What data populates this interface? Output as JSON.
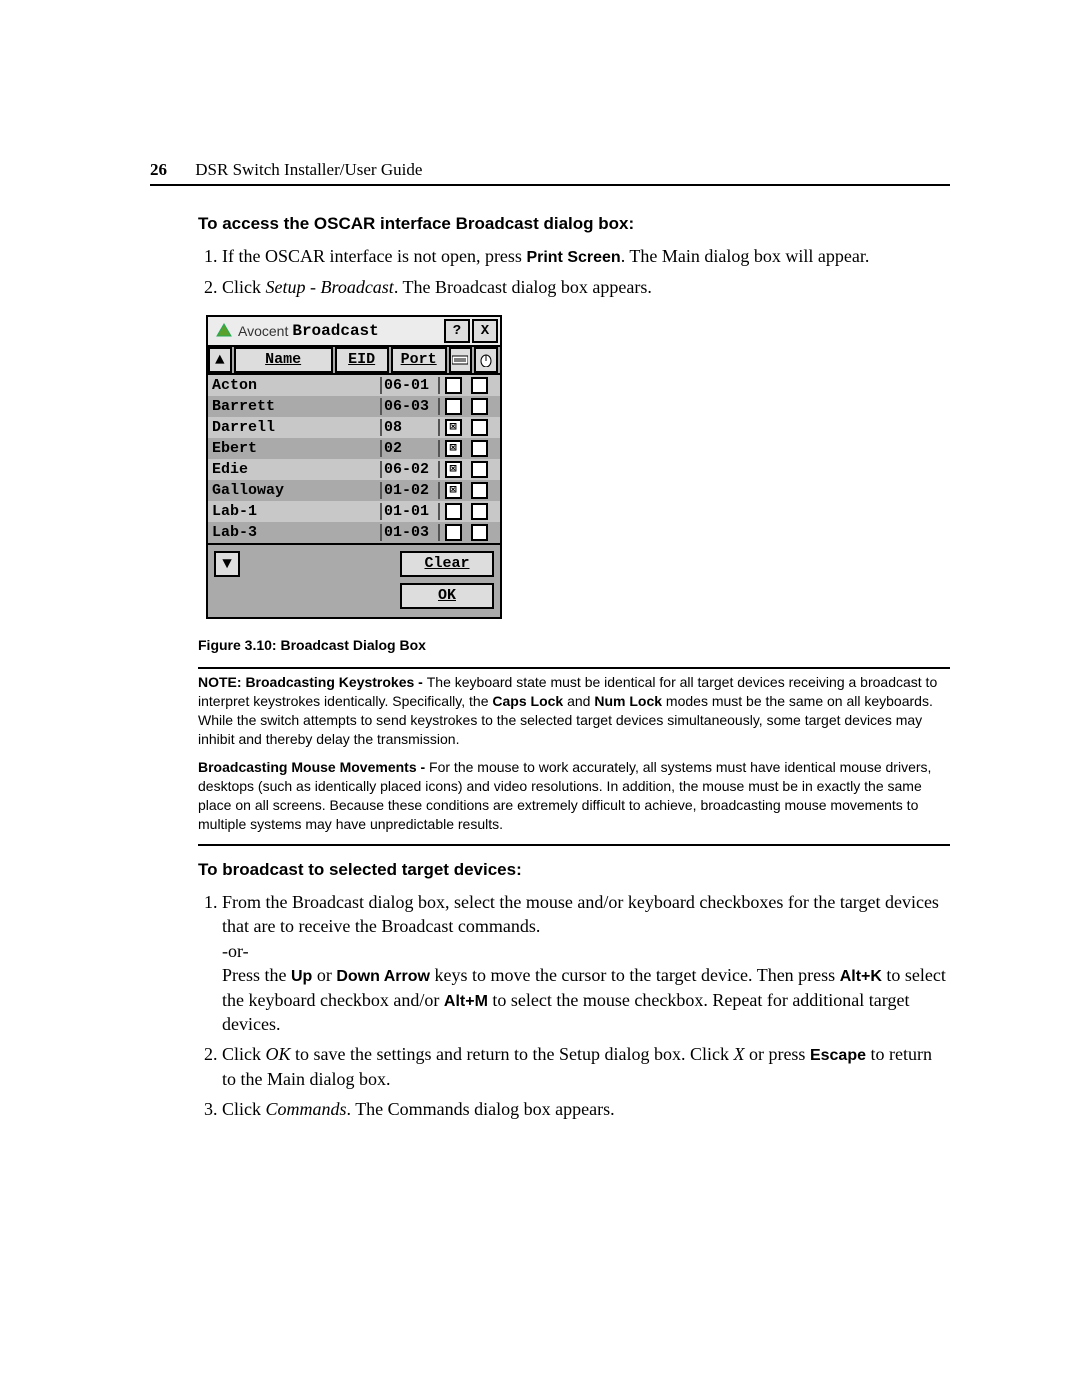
{
  "header": {
    "page_number": "26",
    "guide_title": "DSR Switch Installer/User Guide"
  },
  "section1": {
    "heading": "To access the OSCAR interface Broadcast dialog box:",
    "step1_a": "If the OSCAR interface is not open, press ",
    "step1_b": "Print Screen",
    "step1_c": ". The Main dialog box will appear.",
    "step2_a": "Click ",
    "step2_b": "Setup - Broadcast",
    "step2_c": ". The Broadcast dialog box appears."
  },
  "dialog": {
    "brand": "Avocent",
    "title": "Broadcast",
    "help_glyph": "?",
    "close_glyph": "X",
    "sort_up_glyph": "▲",
    "scroll_down_glyph": "▼",
    "cols": {
      "name": "Name",
      "eid": "EID",
      "port": "Port"
    },
    "keyboard_icon": "⌨",
    "mouse_icon": "🖱",
    "rows": [
      {
        "name": "Acton",
        "port": "06-01",
        "kb": false,
        "mouse": false
      },
      {
        "name": "Barrett",
        "port": "06-03",
        "kb": false,
        "mouse": false
      },
      {
        "name": "Darrell",
        "port": "08",
        "kb": true,
        "mouse": false
      },
      {
        "name": "Ebert",
        "port": "02",
        "kb": true,
        "mouse": false
      },
      {
        "name": "Edie",
        "port": "06-02",
        "kb": true,
        "mouse": false
      },
      {
        "name": "Galloway",
        "port": "01-02",
        "kb": true,
        "mouse": false
      },
      {
        "name": "Lab-1",
        "port": "01-01",
        "kb": false,
        "mouse": false
      },
      {
        "name": "Lab-3",
        "port": "01-03",
        "kb": false,
        "mouse": false
      }
    ],
    "clear_btn": "Clear",
    "ok_btn": "OK"
  },
  "figure_caption": "Figure 3.10: Broadcast Dialog Box",
  "note1": {
    "label": "NOTE: Broadcasting Keystrokes - ",
    "text_a": "The keyboard state must be identical for all target devices receiving a broadcast to interpret keystrokes identically. Specifically, the ",
    "caps": "Caps Lock",
    "and": " and ",
    "num": "Num Lock",
    "text_b": " modes must be the same on all keyboards. While the switch attempts to send keystrokes to the selected target devices simultaneously, some target devices may inhibit and thereby delay the transmission."
  },
  "note2": {
    "label": "Broadcasting Mouse Movements - ",
    "text": "For the mouse to work accurately, all systems must have identical mouse drivers, desktops (such as identically placed icons) and video resolutions. In addition, the mouse must be in exactly the same place on all screens. Because these conditions are extremely difficult to achieve, broadcasting mouse movements to multiple systems may have unpredictable results."
  },
  "section2": {
    "heading": "To broadcast to selected target devices:",
    "step1_a": "From the Broadcast dialog box, select the mouse and/or keyboard checkboxes for the target devices that are to receive the Broadcast commands.",
    "step1_or": "-or-",
    "step1_b1": "Press the ",
    "up": "Up",
    "or": " or ",
    "down": "Down Arrow",
    "step1_b2": " keys to move the cursor to the target device. Then press ",
    "altk": "Alt+K",
    "step1_b3": " to select the keyboard checkbox and/or ",
    "altm": "Alt+M",
    "step1_b4": " to select the mouse checkbox. Repeat for additional target devices.",
    "step2_a": "Click ",
    "step2_ok": "OK",
    "step2_b": " to save the settings and return to the Setup dialog box. Click ",
    "step2_x": "X",
    "step2_c": " or press ",
    "step2_esc": "Escape",
    "step2_d": " to return to the Main dialog box.",
    "step3_a": "Click ",
    "step3_cmd": "Commands",
    "step3_b": ". The Commands dialog box appears."
  }
}
